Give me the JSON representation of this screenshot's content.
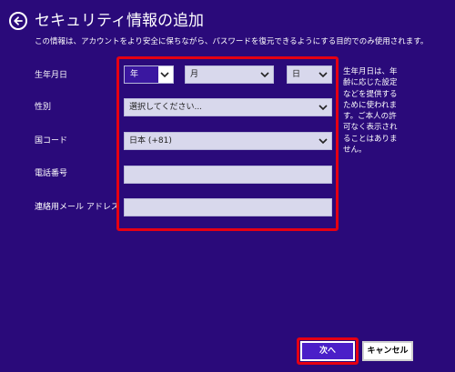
{
  "header": {
    "title": "セキュリティ情報の追加",
    "back_icon": "back-arrow-circle-icon"
  },
  "description": "この情報は、アカウントをより安全に保ちながら、パスワードを復元できるようにする目的でのみ使用されます。",
  "form": {
    "birthdate": {
      "label": "生年月日",
      "year": "年",
      "month": "月",
      "day": "日"
    },
    "gender": {
      "label": "性別",
      "value": "選択してください..."
    },
    "country_code": {
      "label": "国コード",
      "value": "日本 (+81)"
    },
    "phone": {
      "label": "電話番号",
      "value": ""
    },
    "email": {
      "label": "連絡用メール アドレス",
      "value": ""
    }
  },
  "side_note": "生年月日は、年齢に応じた設定などを提供するために使われます。ご本人の許可なく表示されることはありません。",
  "buttons": {
    "next": "次へ",
    "cancel": "キャンセル"
  },
  "colors": {
    "background": "#2a0a7a",
    "highlight": "#e60012",
    "field": "#d8d8ec",
    "selected": "#3a17a0"
  }
}
